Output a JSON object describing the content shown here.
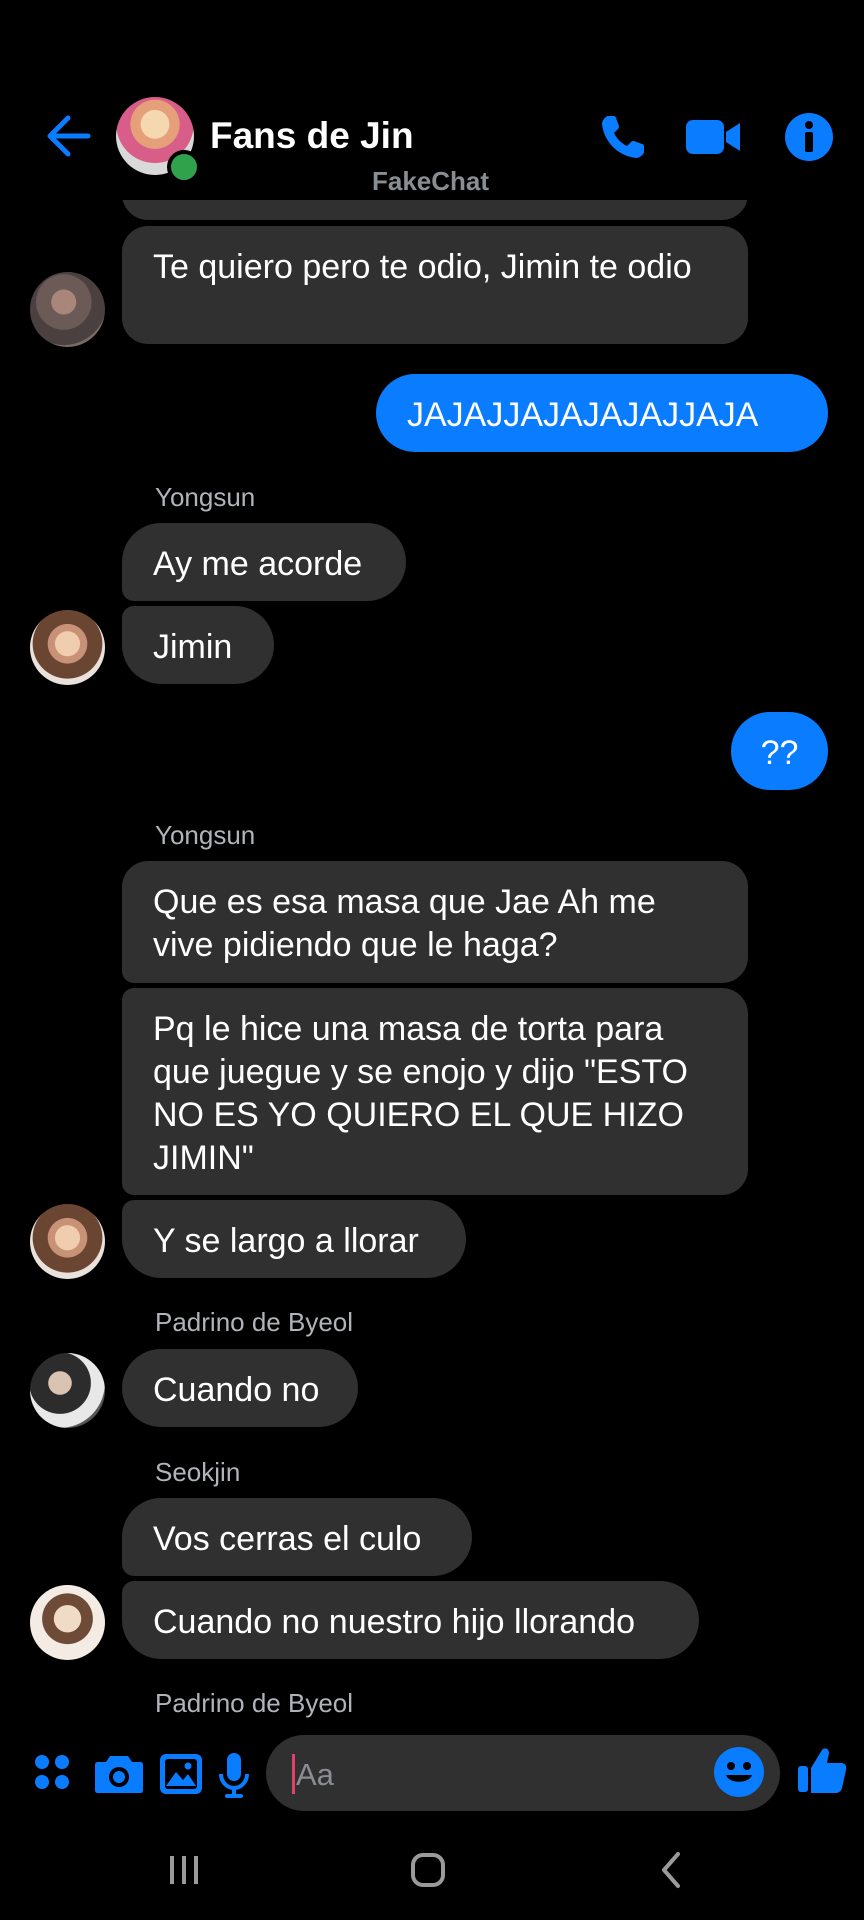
{
  "header": {
    "title": "Fans de Jin",
    "watermark": "FakeChat",
    "accent": "#0a7cff",
    "icons": [
      "back-arrow-icon",
      "phone-icon",
      "video-camera-icon",
      "info-icon"
    ]
  },
  "messages": [
    {
      "sender": "",
      "text": "Te quiero pero te odio, Jimin te odio",
      "side": "them"
    },
    {
      "sender": "",
      "text": "JAJAJJAJAJAJAJJAJA",
      "side": "me"
    },
    {
      "sender": "Yongsun",
      "text": "Ay me acorde",
      "side": "them"
    },
    {
      "sender": "",
      "text": "Jimin",
      "side": "them"
    },
    {
      "sender": "",
      "text": "??",
      "side": "me"
    },
    {
      "sender": "Yongsun",
      "text": "Que es esa masa que Jae Ah me vive pidiendo que le haga?",
      "side": "them"
    },
    {
      "sender": "",
      "text": "Pq le hice una masa de torta para que juegue y se enojo y dijo \"ESTO NO ES YO QUIERO EL QUE HIZO JIMIN\"",
      "side": "them"
    },
    {
      "sender": "",
      "text": "Y se largo a llorar",
      "side": "them"
    },
    {
      "sender": "Padrino de Byeol",
      "text": "Cuando no",
      "side": "them"
    },
    {
      "sender": "Seokjin",
      "text": "Vos cerras el culo",
      "side": "them"
    },
    {
      "sender": "",
      "text": "Cuando no nuestro hijo llorando",
      "side": "them"
    }
  ],
  "trailing_sender": "Padrino de Byeol",
  "composer": {
    "placeholder": "Aa",
    "icons": [
      "menu-dots-icon",
      "camera-icon",
      "gallery-icon",
      "microphone-icon",
      "emoji-icon",
      "thumbs-up-icon"
    ]
  },
  "system_nav": [
    "recents-icon",
    "home-icon",
    "back-icon"
  ]
}
